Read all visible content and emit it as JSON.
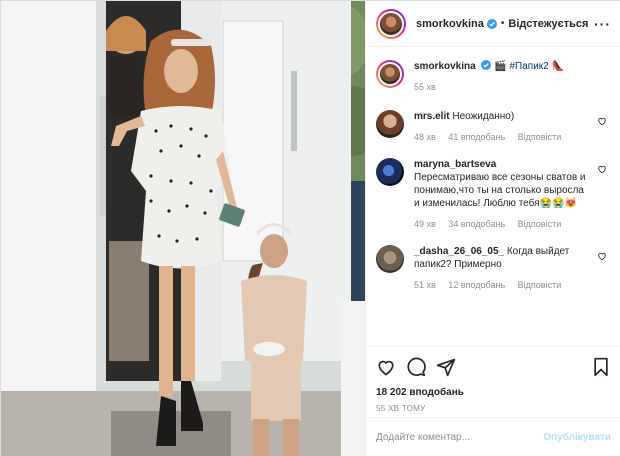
{
  "header": {
    "username": "smorkovkina",
    "follow_status": "Відстежується",
    "more_icon": "more-dots-icon"
  },
  "caption": {
    "username": "smorkovkina",
    "emoji_clapper": "🎬",
    "hashtag": "#Папик2",
    "emoji_shoe": "👠",
    "time": "55 хв"
  },
  "comments": [
    {
      "username": "mrs.elit",
      "text": "Неожиданно)",
      "time": "48 хв",
      "likes": "41 вподобань",
      "reply": "Відповісти"
    },
    {
      "username": "maryna_bartseva",
      "text": "Пересматриваю все сезоны сватов и понимаю,что ты на столько выросла и изменилась! Люблю тебя😭😭😻",
      "time": "49 хв",
      "likes": "34 вподобань",
      "reply": "Відповісти"
    },
    {
      "username": "_dasha_26_06_05_",
      "text": "Когда выйдет папик2? Примерно",
      "time": "51 хв",
      "likes": "12 вподобань",
      "reply": "Відповісти"
    }
  ],
  "post": {
    "likes": "18 202 вподобань",
    "time": "55 ХВ ТОМУ"
  },
  "add_comment": {
    "placeholder": "Додайте коментар...",
    "publish_label": "Опублікувати"
  },
  "colors": {
    "link": "#00376b",
    "muted": "#8e8e8e",
    "publish_disabled": "#b2dffc",
    "verified": "#3897f0"
  }
}
